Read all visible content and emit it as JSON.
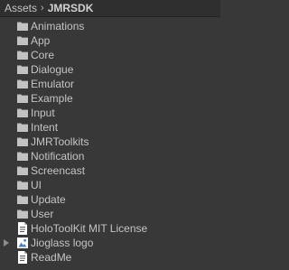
{
  "breadcrumb": {
    "items": [
      "Assets",
      "JMRSDK"
    ],
    "separator": "›"
  },
  "colors": {
    "background": "#383838",
    "text": "#c4c4c4",
    "folder": "#c2c2c2",
    "document": "#ffffff"
  },
  "items": [
    {
      "label": "Animations",
      "icon": "folder-icon"
    },
    {
      "label": "App",
      "icon": "folder-icon"
    },
    {
      "label": "Core",
      "icon": "folder-icon"
    },
    {
      "label": "Dialogue",
      "icon": "folder-icon"
    },
    {
      "label": "Emulator",
      "icon": "folder-icon"
    },
    {
      "label": "Example",
      "icon": "folder-icon"
    },
    {
      "label": "Input",
      "icon": "folder-icon"
    },
    {
      "label": "Intent",
      "icon": "folder-icon"
    },
    {
      "label": "JMRToolkits",
      "icon": "folder-icon"
    },
    {
      "label": "Notification",
      "icon": "folder-icon"
    },
    {
      "label": "Screencast",
      "icon": "folder-icon"
    },
    {
      "label": "UI",
      "icon": "folder-icon"
    },
    {
      "label": "Update",
      "icon": "folder-icon"
    },
    {
      "label": "User",
      "icon": "folder-icon"
    },
    {
      "label": "HoloToolKit MIT License",
      "icon": "text-document-icon"
    },
    {
      "label": "Jioglass logo",
      "icon": "image-asset-icon",
      "expandable": true
    },
    {
      "label": "ReadMe",
      "icon": "text-document-icon"
    }
  ]
}
